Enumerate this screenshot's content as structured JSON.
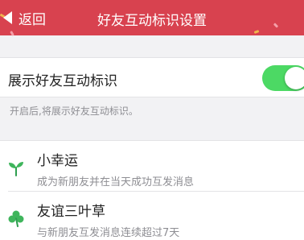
{
  "navbar": {
    "back_label": "返回",
    "title": "好友互动标识设置",
    "background": "#d8424f"
  },
  "toggle": {
    "label": "展示好友互动标识",
    "state": "on",
    "on_color": "#4cd964"
  },
  "hint": "开启后,将展示好友互动标识。",
  "badges": [
    {
      "icon": "sprout-icon",
      "title": "小幸运",
      "description": "成为新朋友并在当天成功互发消息"
    },
    {
      "icon": "clover-icon",
      "title": "友谊三叶草",
      "description": "与新朋友互发消息连续超过7天"
    }
  ]
}
